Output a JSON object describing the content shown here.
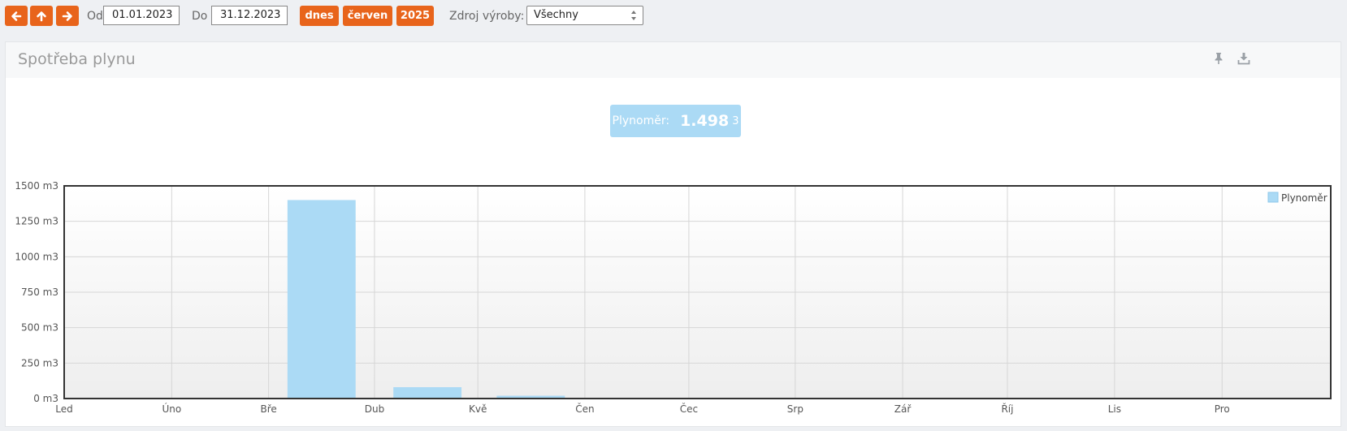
{
  "toolbar": {
    "prev_icon": "arrow-left-icon",
    "up_icon": "arrow-up-icon",
    "next_icon": "arrow-right-icon",
    "from_label": "Od",
    "from_value": "01.01.2023",
    "to_label": "Do",
    "to_value": "31.12.2023",
    "today_label": "dnes",
    "month_label": "červen",
    "year_label": "2025",
    "source_label": "Zdroj výroby:",
    "source_value": "Všechny",
    "accent_color": "#e8641b"
  },
  "panel": {
    "title": "Spotřeba plynu",
    "pin_icon": "pin-icon",
    "download_icon": "download-icon"
  },
  "summary": {
    "label": "Plynoměr:",
    "value": "1.498",
    "unit": "3",
    "color": "#abdaf5"
  },
  "chart_data": {
    "type": "bar",
    "categories": [
      "Led",
      "Úno",
      "Bře",
      "Dub",
      "Kvě",
      "Čen",
      "Čec",
      "Srp",
      "Zář",
      "Říj",
      "Lis",
      "Pro"
    ],
    "series": [
      {
        "name": "Plynoměr",
        "color": "#abdaf5",
        "values": [
          0,
          0,
          1400,
          80,
          20,
          0,
          0,
          0,
          0,
          0,
          0,
          0
        ]
      }
    ],
    "ylim": [
      0,
      1500
    ],
    "yticks": [
      "0 m3",
      "250 m3",
      "500 m3",
      "750 m3",
      "1000 m3",
      "1250 m3",
      "1500 m3"
    ],
    "ytick_values": [
      0,
      250,
      500,
      750,
      1000,
      1250,
      1500
    ],
    "grid": true,
    "legend_position": "top-right"
  }
}
